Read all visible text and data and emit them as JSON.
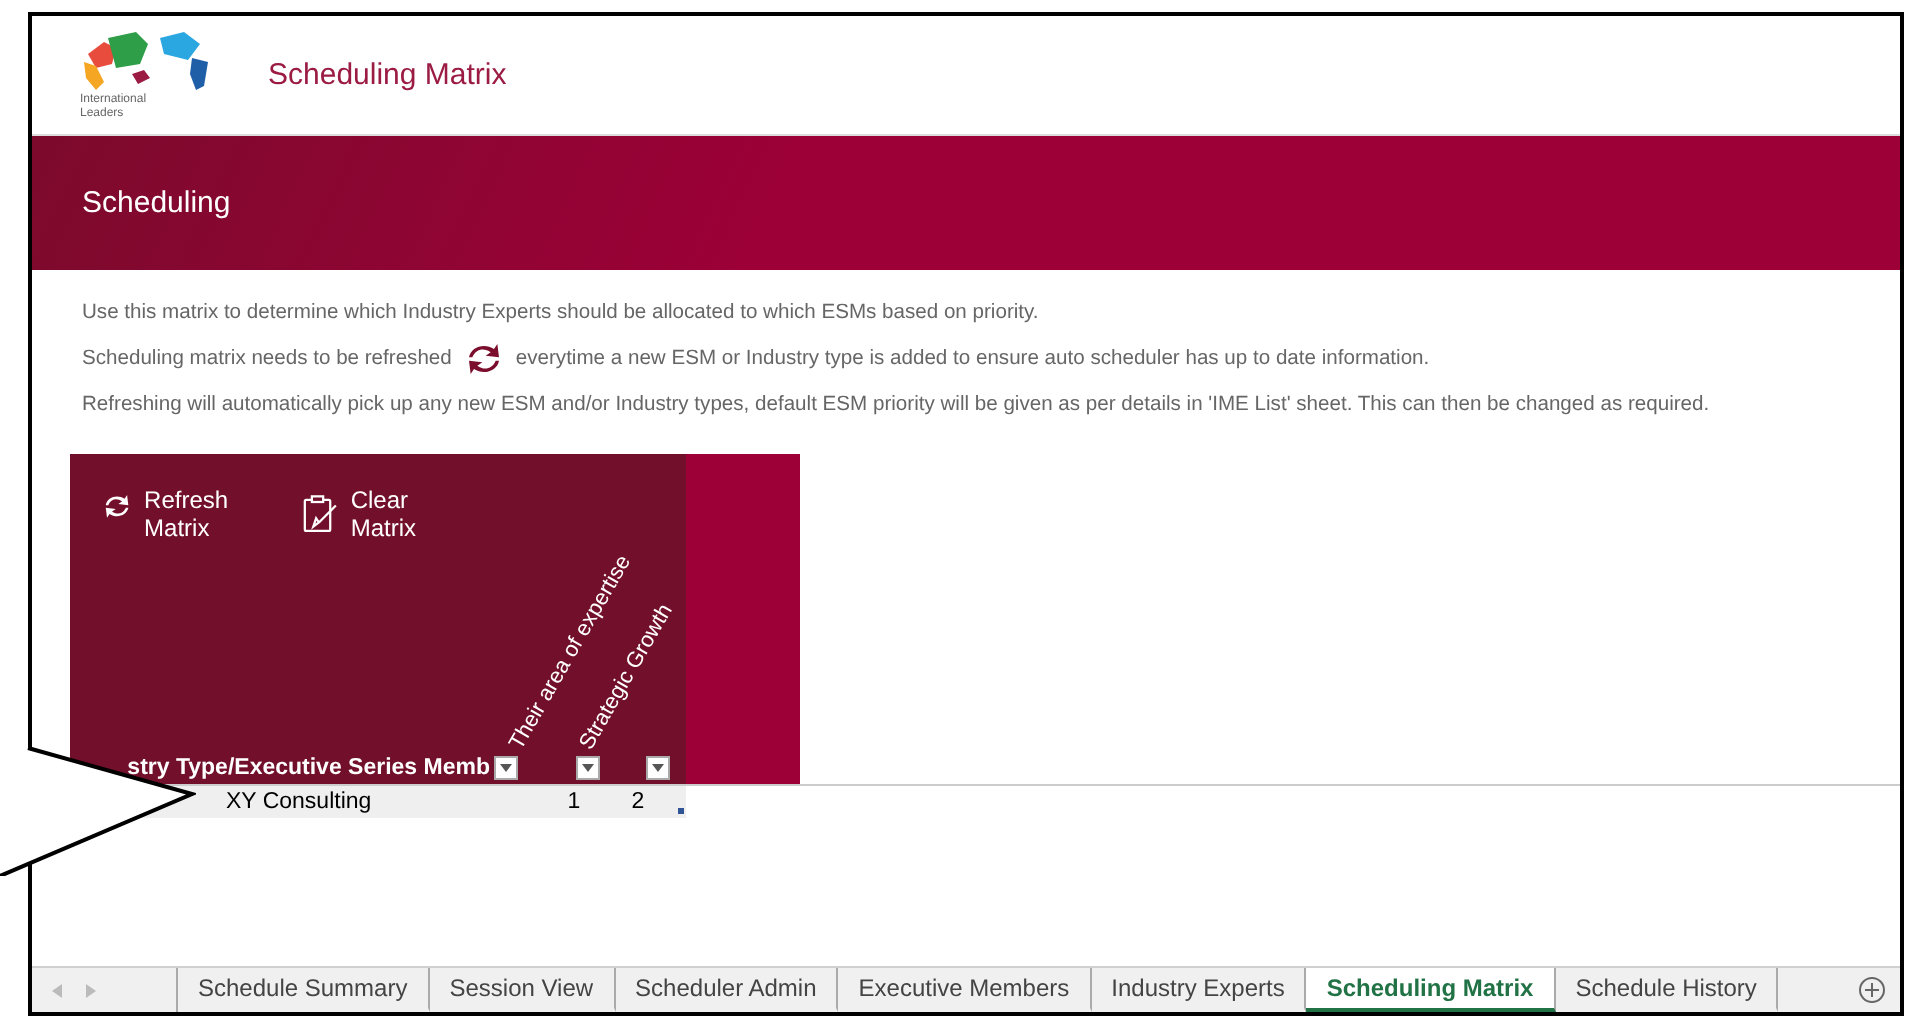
{
  "header": {
    "logo_text": [
      "International",
      "Leaders"
    ],
    "title": "Scheduling Matrix"
  },
  "banner": {
    "title": "Scheduling"
  },
  "instructions": [
    {
      "before": "Use this matrix to determine which Industry Experts should be allocated to which ESMs based on priority."
    },
    {
      "before": "Scheduling matrix needs to be refreshed",
      "after": "everytime a new ESM or Industry type is added to ensure auto scheduler has up to date information.",
      "kind": "icon"
    },
    {
      "before": "Refreshing will automatically pick up any new ESM and/or Industry types, default ESM priority will be given as per details in 'IME List' sheet. This can then be changed as required."
    }
  ],
  "matrix": {
    "buttons": [
      {
        "label": "Refresh Matrix",
        "kind": "refresh"
      },
      {
        "label": "Clear Matrix",
        "kind": "clear"
      }
    ],
    "columns": [
      "stry Type/Executive Series Memb",
      "Their area of expertise",
      "Strategic Growth"
    ],
    "rows": [
      {
        "name": "XY Consulting",
        "values": [
          "1",
          "2"
        ]
      }
    ]
  },
  "sheet_tabs": [
    {
      "label": "Schedule Summary",
      "selected": false
    },
    {
      "label": "Session View",
      "selected": false
    },
    {
      "label": "Scheduler Admin",
      "selected": false
    },
    {
      "label": "Executive Members",
      "selected": false
    },
    {
      "label": "Industry Experts",
      "selected": false
    },
    {
      "label": "Scheduling Matrix",
      "selected": true
    },
    {
      "label": "Schedule History",
      "selected": false
    }
  ]
}
